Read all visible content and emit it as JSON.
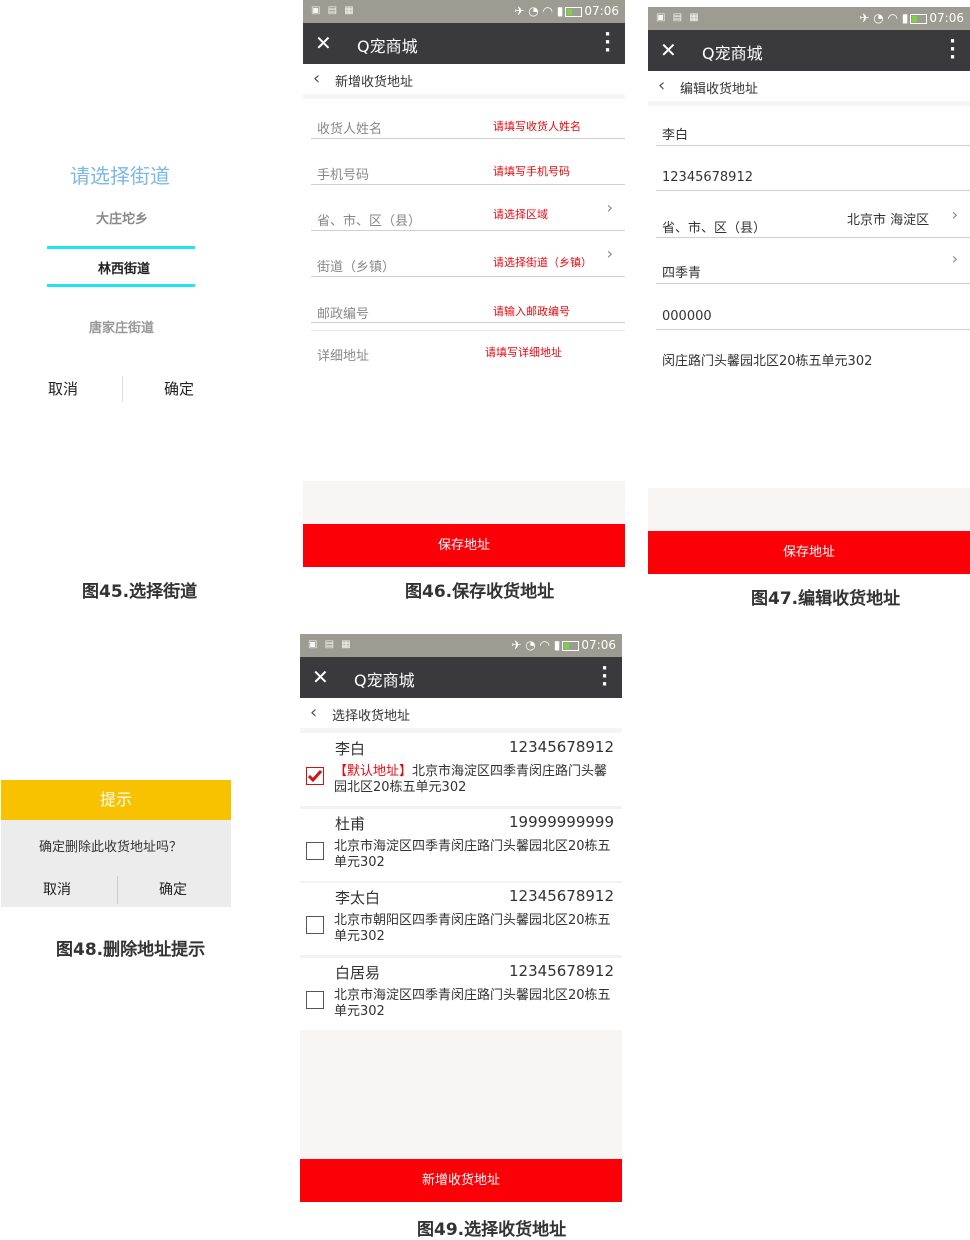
{
  "fig45": {
    "title": "请选择街道",
    "options": [
      "大庄坨乡",
      "林西街道",
      "唐家庄街道"
    ],
    "cancel": "取消",
    "confirm": "确定",
    "caption": "图45.选择街道"
  },
  "phone": {
    "time": "07:06",
    "app_title": "Q宠商城"
  },
  "fig46": {
    "nav_title": "新增收货地址",
    "fields": [
      {
        "label": "收货人姓名",
        "hint": "请填写收货人姓名"
      },
      {
        "label": "手机号码",
        "hint": "请填写手机号码"
      },
      {
        "label": "省、市、区（县）",
        "hint": "请选择区域"
      },
      {
        "label": "街道（乡镇）",
        "hint": "请选择街道（乡镇）"
      },
      {
        "label": "邮政编号",
        "hint": "请输入邮政编号"
      },
      {
        "label": "详细地址",
        "hint": "请填写详细地址"
      }
    ],
    "save_label": "保存地址",
    "caption": "图46.保存收货地址"
  },
  "fig47": {
    "nav_title": "编辑收货地址",
    "name": "李白",
    "phone": "12345678912",
    "region_label": "省、市、区（县）",
    "region_value": "北京市 海淀区",
    "street": "四季青",
    "postcode": "000000",
    "detail": "闵庄路门头馨园北区20栋五单元302",
    "save_label": "保存地址",
    "caption": "图47.编辑收货地址"
  },
  "fig48": {
    "title": "提示",
    "message": "确定删除此收货地址吗？",
    "cancel": "取消",
    "confirm": "确定",
    "caption": "图48.删除地址提示"
  },
  "fig49": {
    "nav_title": "选择收货地址",
    "addresses": [
      {
        "name": "李白",
        "phone": "12345678912",
        "tag": "【默认地址】",
        "address": "北京市海淀区四季青闵庄路门头馨园北区20栋五单元302",
        "checked": true
      },
      {
        "name": "杜甫",
        "phone": "19999999999",
        "tag": "",
        "address": "北京市海淀区四季青闵庄路门头馨园北区20栋五单元302",
        "checked": false
      },
      {
        "name": "李太白",
        "phone": "12345678912",
        "tag": "",
        "address": "北京市朝阳区四季青闵庄路门头馨园北区20栋五单元302",
        "checked": false
      },
      {
        "name": "白居易",
        "phone": "12345678912",
        "tag": "",
        "address": "北京市海淀区四季青闵庄路门头馨园北区20栋五单元302",
        "checked": false
      }
    ],
    "add_label": "新增收货地址",
    "caption": "图49.选择收货地址"
  },
  "colors": {
    "accent_red": "#fb0006",
    "hint_red": "#e8080e",
    "dialog_yellow": "#f8c200",
    "picker_cyan": "#20e5f0",
    "picker_title": "#7ab8e6",
    "titlebar": "#3a3a3c"
  },
  "icons": [
    "close-icon",
    "more-icon",
    "back-icon",
    "chevron-right-icon",
    "checkbox-icon",
    "battery-icon"
  ]
}
